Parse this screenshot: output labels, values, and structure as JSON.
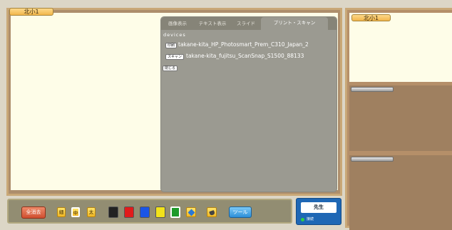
{
  "board": {
    "tag": "北小1"
  },
  "panel": {
    "tabs": [
      "画像表示",
      "テキスト表示",
      "スライド",
      "プリント・スキャン"
    ],
    "devices_label": "devices",
    "devices": [
      {
        "button": "印刷",
        "name": "takane-kita_HP_Photosmart_Prem_C310_Japan_2"
      },
      {
        "button": "スキャン",
        "name": "takane-kita_fujitsu_ScanSnap_S1500_88133"
      }
    ],
    "close_label": "閉じる"
  },
  "toolbar": {
    "clear_all": "全消去",
    "sizes": [
      "細",
      "中",
      "太"
    ],
    "colors": [
      "#222222",
      "#e11b1b",
      "#1a55e6",
      "#f2e21a",
      "#1f9a2b"
    ],
    "tool_label": "ツール"
  },
  "teacher": {
    "label": "先生",
    "status": "接続",
    "status_color": "#2fcf42"
  },
  "right": {
    "tag": "北小1"
  }
}
